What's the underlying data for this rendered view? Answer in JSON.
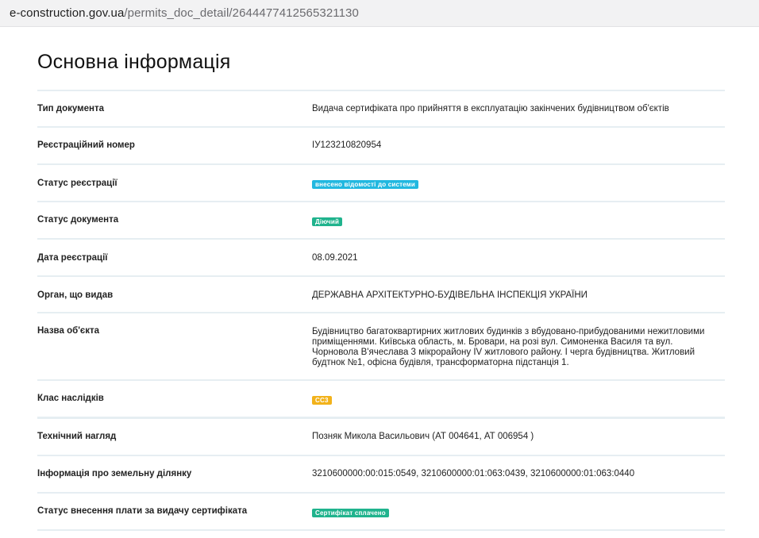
{
  "address_bar": {
    "domain": "e-construction.gov.ua",
    "path": "/permits_doc_detail/2644477412565321130"
  },
  "page": {
    "title": "Основна інформація"
  },
  "fields": {
    "doc_type": {
      "label": "Тип документа",
      "value": "Видача сертифіката про прийняття в експлуатацію закінчених будівництвом об'єктів"
    },
    "reg_number": {
      "label": "Реєстраційний номер",
      "value": "ІУ123210820954"
    },
    "reg_status": {
      "label": "Статус реєстрації",
      "badge": "внесено відомості до системи",
      "badge_color": "#22b8e0"
    },
    "doc_status": {
      "label": "Статус документа",
      "badge": "Діючий",
      "badge_color": "#20b38d"
    },
    "reg_date": {
      "label": "Дата реєстрації",
      "value": "08.09.2021"
    },
    "issuer": {
      "label": "Орган, що видав",
      "value": "ДЕРЖАВНА АРХІТЕКТУРНО-БУДІВЕЛЬНА ІНСПЕКЦІЯ УКРАЇНИ"
    },
    "object_name": {
      "label": "Назва об'єкта",
      "value": "Будівництво багатоквартирних житлових будинків з вбудовано-прибудованими нежитловими приміщеннями. Київська область, м. Бровари, на розі вул. Симоненка Василя та вул. Чорновола В'ячеслава 3 мікрорайону IV житлового району. І черга будівництва. Житловий будтнок №1, офісна будівля, трансформаторна підстанція 1."
    },
    "consequence_class": {
      "label": "Клас наслідків",
      "badge": "СС3",
      "badge_color": "#f2b21b"
    },
    "tech_supervision": {
      "label": "Технічний нагляд",
      "value": "Позняк Микола Васильович (АТ 004641, АТ 006954 )"
    },
    "land_info": {
      "label": "Інформація про земельну ділянку",
      "value": "3210600000:00:015:0549, 3210600000:01:063:0439, 3210600000:01:063:0440"
    },
    "fee_status": {
      "label": "Статус внесення плати за видачу сертифіката",
      "badge": "Сертифікат сплачено",
      "badge_color": "#20b38d"
    }
  }
}
